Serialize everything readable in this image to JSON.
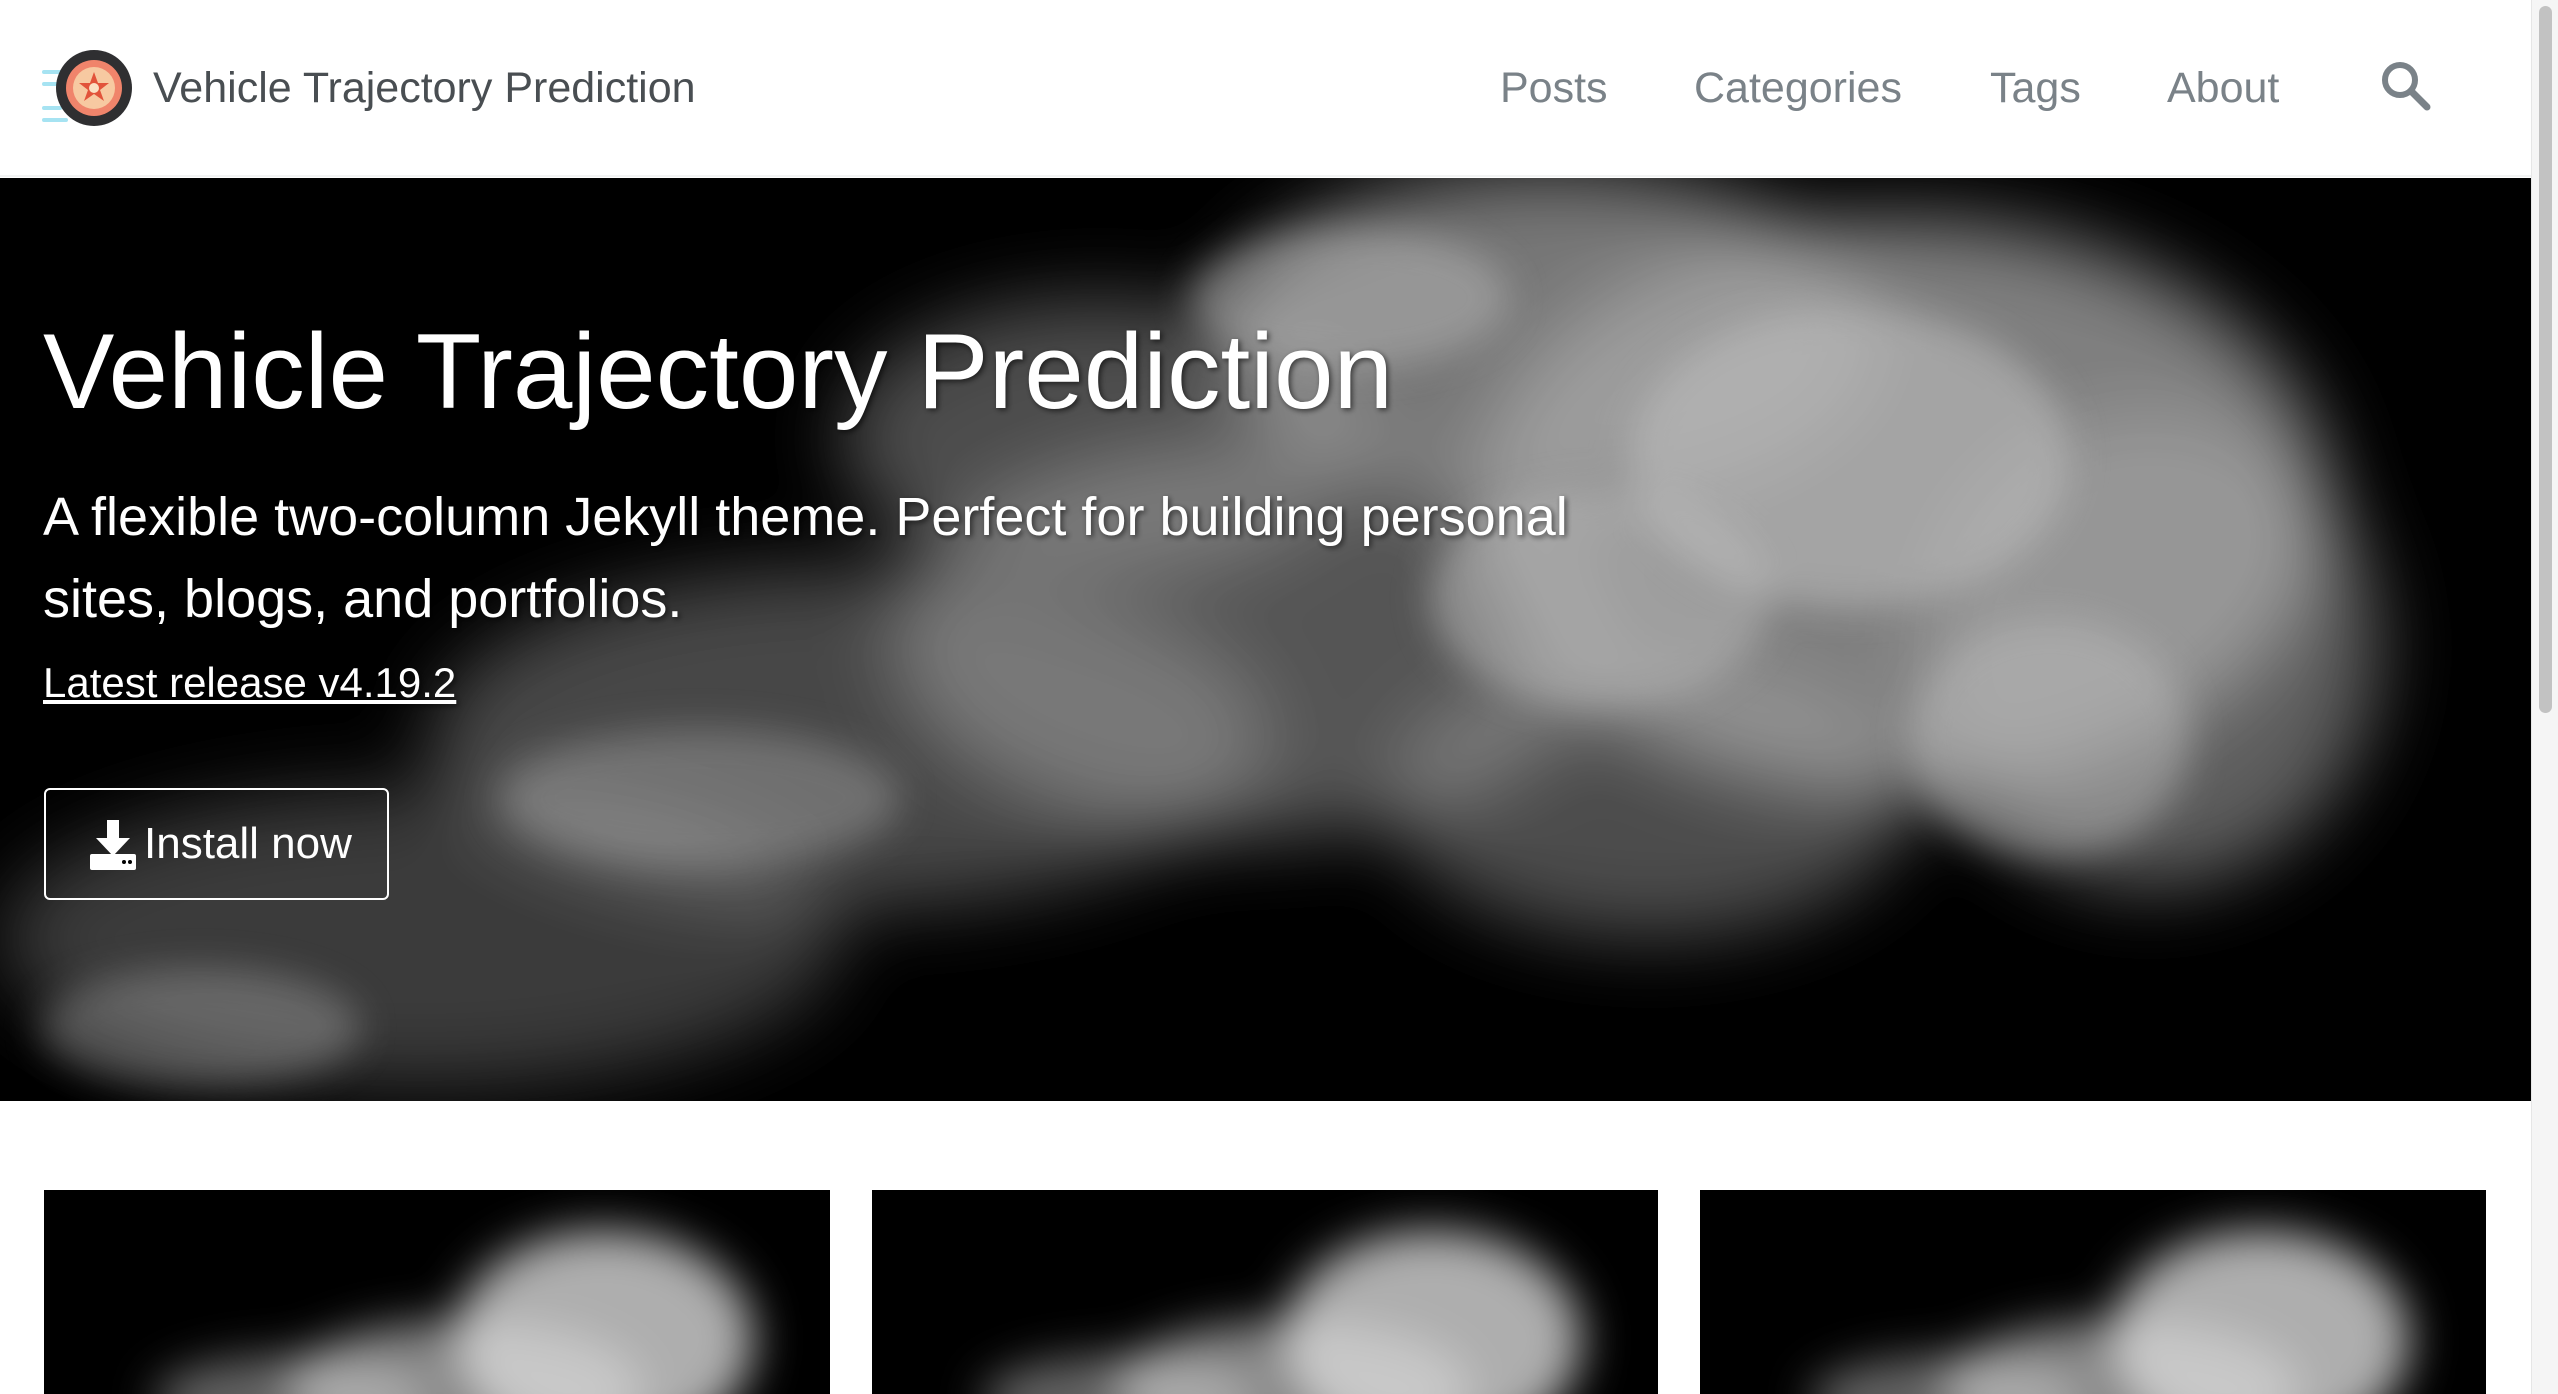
{
  "masthead": {
    "site_title": "Vehicle Trajectory Prediction",
    "logo_icon": "film-reel-logo-icon",
    "nav": {
      "posts": "Posts",
      "categories": "Categories",
      "tags": "Tags",
      "about": "About"
    },
    "search_icon": "search-icon"
  },
  "hero": {
    "title": "Vehicle Trajectory Prediction",
    "tagline": "A flexible two-column Jekyll theme. Perfect for building personal sites, blogs, and portfolios.",
    "release_link": "Latest release v4.19.2",
    "install_button": "Install now",
    "install_icon": "download-icon"
  },
  "colors": {
    "nav_text": "#7a8288",
    "title_text": "#494e52",
    "hero_bg": "#000000",
    "logo_ring": "#3b3b3b",
    "logo_accent": "#f28c6e"
  }
}
